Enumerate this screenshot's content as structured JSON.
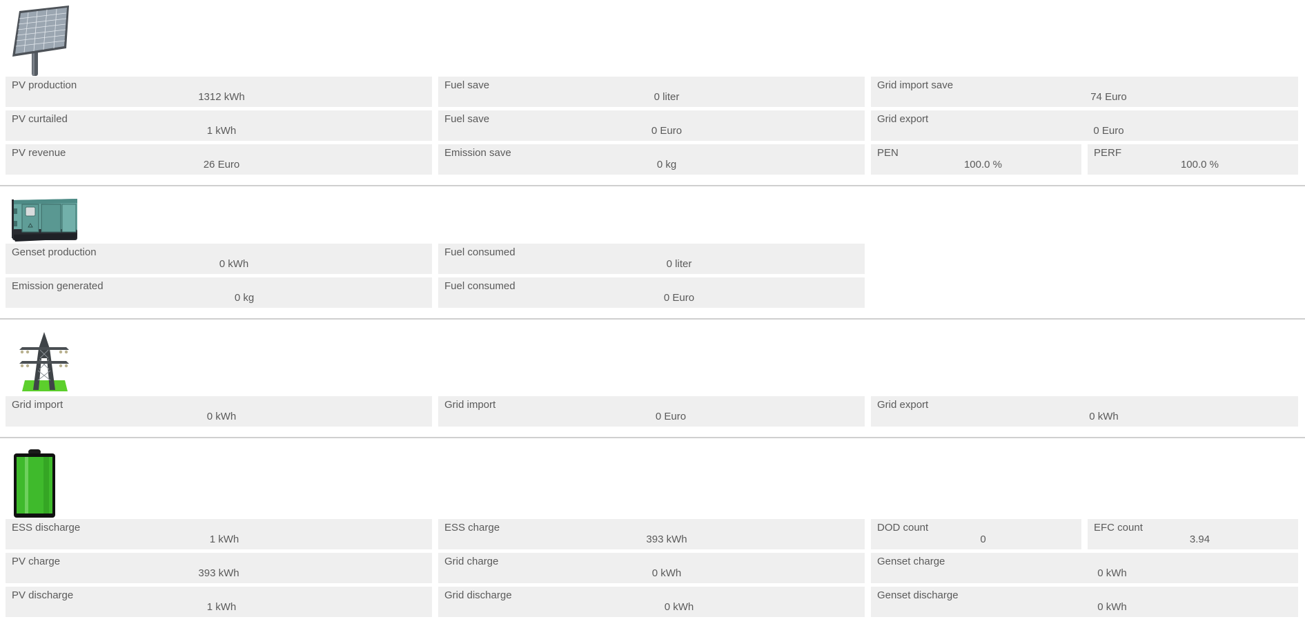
{
  "pv": {
    "icon": "solar-panel-icon",
    "metrics": [
      {
        "label": "PV production",
        "value": "1312 kWh"
      },
      {
        "label": "Fuel save",
        "value": "0 liter"
      },
      {
        "label": "Grid import save",
        "value": "74 Euro"
      },
      {
        "label": "PV curtailed",
        "value": "1 kWh"
      },
      {
        "label": "Fuel save",
        "value": "0 Euro"
      },
      {
        "label": "Grid export",
        "value": "0 Euro"
      },
      {
        "label": "PV revenue",
        "value": "26 Euro"
      },
      {
        "label": "Emission save",
        "value": "0 kg"
      },
      {
        "label": "PEN",
        "value": "100.0 %"
      },
      {
        "label": "PERF",
        "value": "100.0 %"
      }
    ]
  },
  "genset": {
    "icon": "generator-icon",
    "metrics": [
      {
        "label": "Genset production",
        "value": "0 kWh"
      },
      {
        "label": "Fuel consumed",
        "value": "0 liter"
      },
      {
        "label": "Emission generated",
        "value": "0 kg"
      },
      {
        "label": "Fuel consumed",
        "value": "0 Euro"
      }
    ]
  },
  "grid": {
    "icon": "power-tower-icon",
    "metrics": [
      {
        "label": "Grid import",
        "value": "0 kWh"
      },
      {
        "label": "Grid import",
        "value": "0 Euro"
      },
      {
        "label": "Grid export",
        "value": "0 kWh"
      }
    ]
  },
  "ess": {
    "icon": "battery-icon",
    "metrics": [
      {
        "label": "ESS discharge",
        "value": "1 kWh"
      },
      {
        "label": "ESS charge",
        "value": "393 kWh"
      },
      {
        "label": "DOD count",
        "value": "0"
      },
      {
        "label": "EFC count",
        "value": "3.94"
      },
      {
        "label": "PV charge",
        "value": "393 kWh"
      },
      {
        "label": "Grid charge",
        "value": "0 kWh"
      },
      {
        "label": "Genset charge",
        "value": "0 kWh"
      },
      {
        "label": "PV discharge",
        "value": "1 kWh"
      },
      {
        "label": "Grid discharge",
        "value": "0 kWh"
      },
      {
        "label": "Genset discharge",
        "value": "0 kWh"
      }
    ]
  }
}
